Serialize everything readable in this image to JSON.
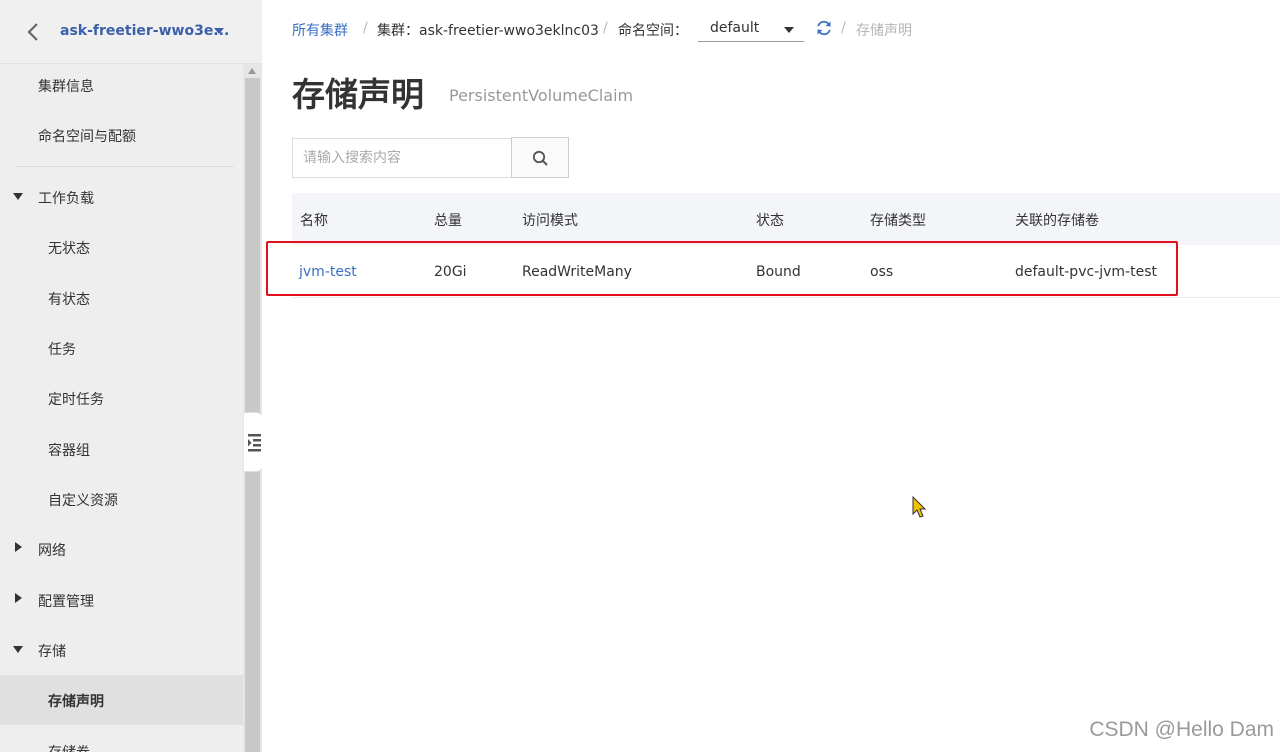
{
  "sidebar": {
    "cluster_name": "ask-freetier-wwo3e...",
    "items": [
      {
        "label": "集群信息"
      },
      {
        "label": "命名空间与配额"
      },
      {
        "label": "工作负载"
      },
      {
        "label": "无状态"
      },
      {
        "label": "有状态"
      },
      {
        "label": "任务"
      },
      {
        "label": "定时任务"
      },
      {
        "label": "容器组"
      },
      {
        "label": "自定义资源"
      },
      {
        "label": "网络"
      },
      {
        "label": "配置管理"
      },
      {
        "label": "存储"
      },
      {
        "label": "存储声明"
      },
      {
        "label": "存储卷"
      }
    ]
  },
  "breadcrumb": {
    "all_clusters": "所有集群",
    "cluster": "集群：ask-freetier-wwo3eklnc03",
    "namespace_label": "命名空间：",
    "namespace_value": "default",
    "current": "存储声明",
    "separator": "/"
  },
  "page": {
    "title": "存储声明",
    "subtitle": "PersistentVolumeClaim"
  },
  "search": {
    "placeholder": "请输入搜索内容"
  },
  "table": {
    "columns": [
      "名称",
      "总量",
      "访问模式",
      "状态",
      "存储类型",
      "关联的存储卷"
    ],
    "rows": [
      [
        "jvm-test",
        "20Gi",
        "ReadWriteMany",
        "Bound",
        "oss",
        "default-pvc-jvm-test"
      ]
    ]
  },
  "watermark": "CSDN @Hello Dam",
  "colors": {
    "accent": "#3b6fc5",
    "highlight": "#e0101c"
  },
  "icons": [
    "back-arrow-icon",
    "chevron-down-icon",
    "refresh-icon",
    "search-icon",
    "collapse-sidebar-icon",
    "mouse-cursor-icon"
  ]
}
